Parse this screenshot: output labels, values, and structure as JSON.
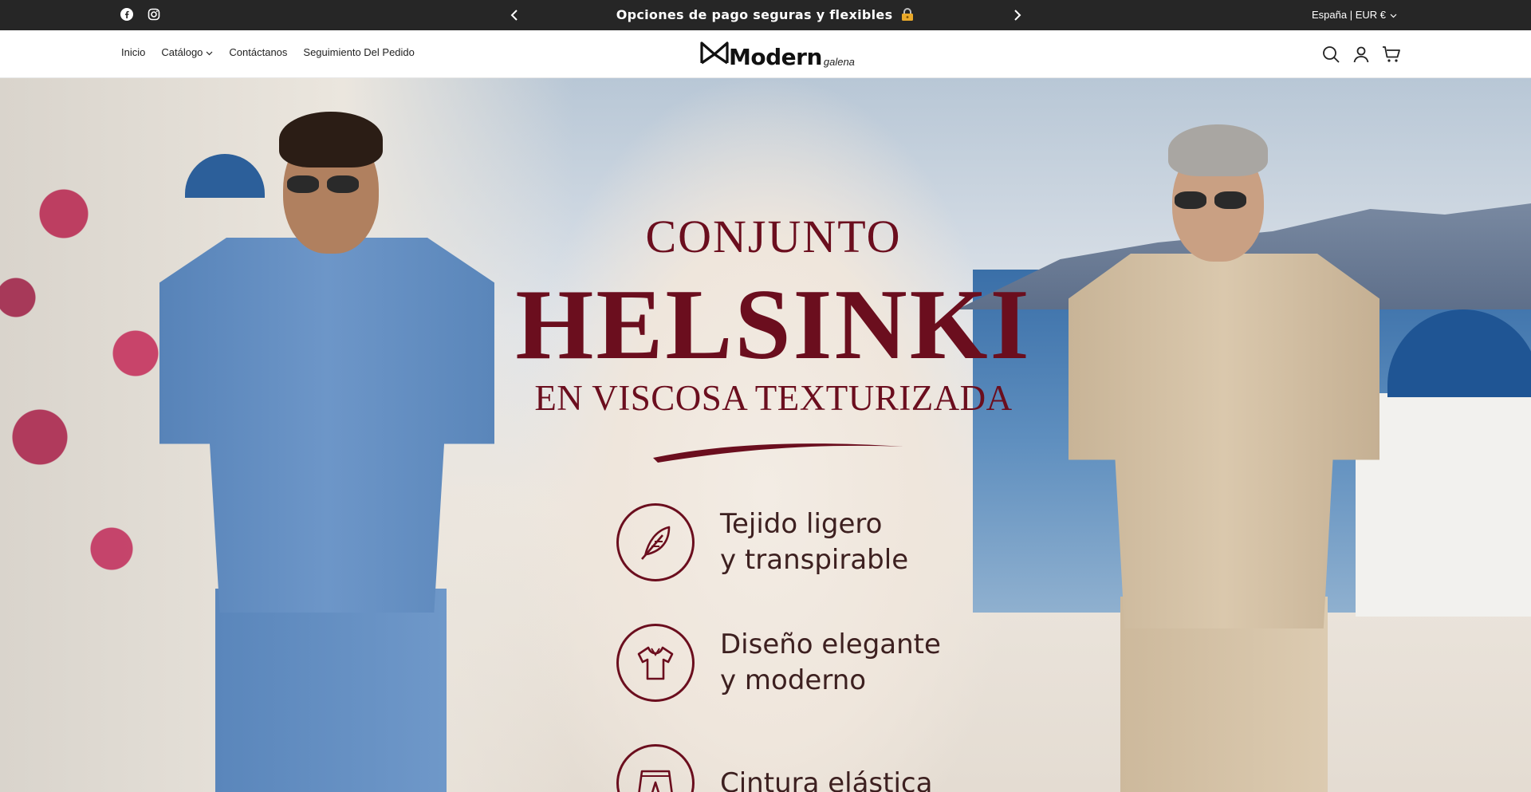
{
  "announcement": {
    "message": "Opciones de pago seguras y flexibles",
    "prev_icon": "chevron-left-icon",
    "next_icon": "chevron-right-icon",
    "locale": "España | EUR €",
    "social": [
      "facebook-icon",
      "instagram-icon"
    ]
  },
  "header": {
    "nav": [
      {
        "label": "Inicio"
      },
      {
        "label": "Catálogo",
        "has_dropdown": true
      },
      {
        "label": "Contáctanos"
      },
      {
        "label": "Seguimiento Del Pedido"
      }
    ],
    "logo": {
      "word": "Modern",
      "sub": "galena"
    },
    "icons": [
      "search-icon",
      "account-icon",
      "cart-icon"
    ]
  },
  "hero": {
    "line1": "CONJUNTO",
    "line2": "HELSINKI",
    "line3": "EN VISCOSA TEXTURIZADA",
    "features": [
      {
        "icon": "feather-icon",
        "line1": "Tejido ligero",
        "line2": "y transpirable"
      },
      {
        "icon": "polo-shirt-icon",
        "line1": "Diseño elegante",
        "line2": "y moderno"
      },
      {
        "icon": "shorts-icon",
        "line1": "Cintura elástica",
        "line2": ""
      }
    ],
    "accent_color": "#6b0e1e"
  }
}
